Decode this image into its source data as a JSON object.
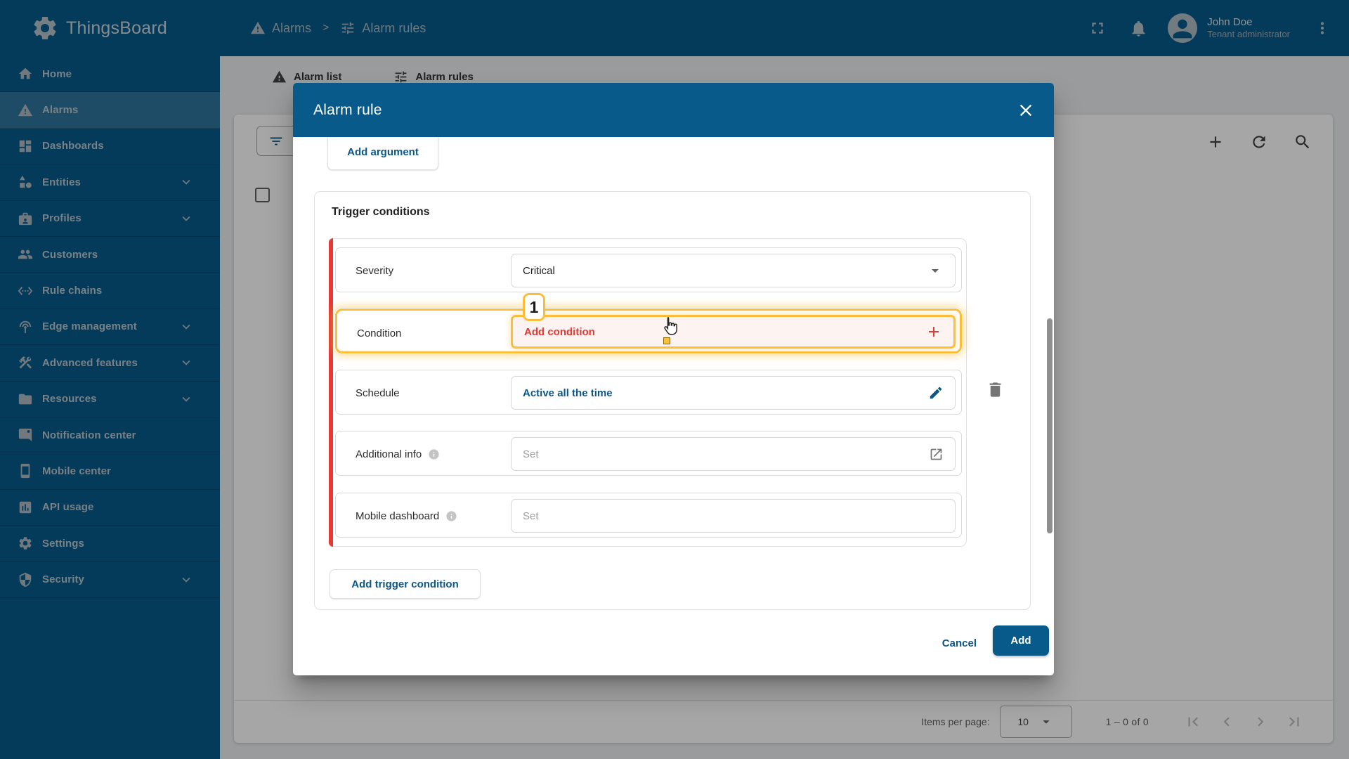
{
  "colors": {
    "primary": "#075a8a",
    "red": "#e53935",
    "hl": "#fbbd3b",
    "link": "#0b5787"
  },
  "app": {
    "title": "ThingsBoard"
  },
  "topbar": {
    "breadcrumb": [
      {
        "icon": "warning",
        "label": "Alarms"
      },
      {
        "icon": "tune",
        "label": "Alarm rules"
      }
    ],
    "separator": ">",
    "user": {
      "name": "John Doe",
      "role": "Tenant administrator"
    }
  },
  "sidebar": {
    "items": [
      {
        "icon": "home",
        "label": "Home"
      },
      {
        "icon": "warning",
        "label": "Alarms",
        "active": true
      },
      {
        "icon": "dashboard",
        "label": "Dashboards"
      },
      {
        "icon": "entities",
        "label": "Entities",
        "expandable": true
      },
      {
        "icon": "profiles",
        "label": "Profiles",
        "expandable": true
      },
      {
        "icon": "customers",
        "label": "Customers"
      },
      {
        "icon": "rule-chains",
        "label": "Rule chains"
      },
      {
        "icon": "edge",
        "label": "Edge management",
        "expandable": true
      },
      {
        "icon": "advanced",
        "label": "Advanced features",
        "expandable": true
      },
      {
        "icon": "folder",
        "label": "Resources",
        "expandable": true
      },
      {
        "icon": "notification",
        "label": "Notification center"
      },
      {
        "icon": "mobile",
        "label": "Mobile center"
      },
      {
        "icon": "api-usage",
        "label": "API usage"
      },
      {
        "icon": "settings",
        "label": "Settings"
      },
      {
        "icon": "security",
        "label": "Security",
        "expandable": true
      }
    ]
  },
  "page": {
    "tabs": [
      {
        "icon": "warning",
        "label": "Alarm list"
      },
      {
        "icon": "tune",
        "label": "Alarm rules"
      }
    ],
    "paginator": {
      "items_per_page_label": "Items per page:",
      "page_size": "10",
      "range": "1 – 0 of 0"
    }
  },
  "modal": {
    "title": "Alarm rule",
    "add_argument_label": "Add argument",
    "section_title": "Trigger conditions",
    "rows": [
      {
        "label": "Severity",
        "value": "Critical"
      },
      {
        "label": "Condition",
        "value": "Add condition",
        "badge": "1"
      },
      {
        "label": "Schedule",
        "value": "Active all the time"
      },
      {
        "label": "Additional info",
        "value": "Set"
      },
      {
        "label": "Mobile dashboard",
        "value": "Set"
      }
    ],
    "add_trigger_label": "Add trigger condition",
    "cancel_label": "Cancel",
    "add_label": "Add"
  }
}
